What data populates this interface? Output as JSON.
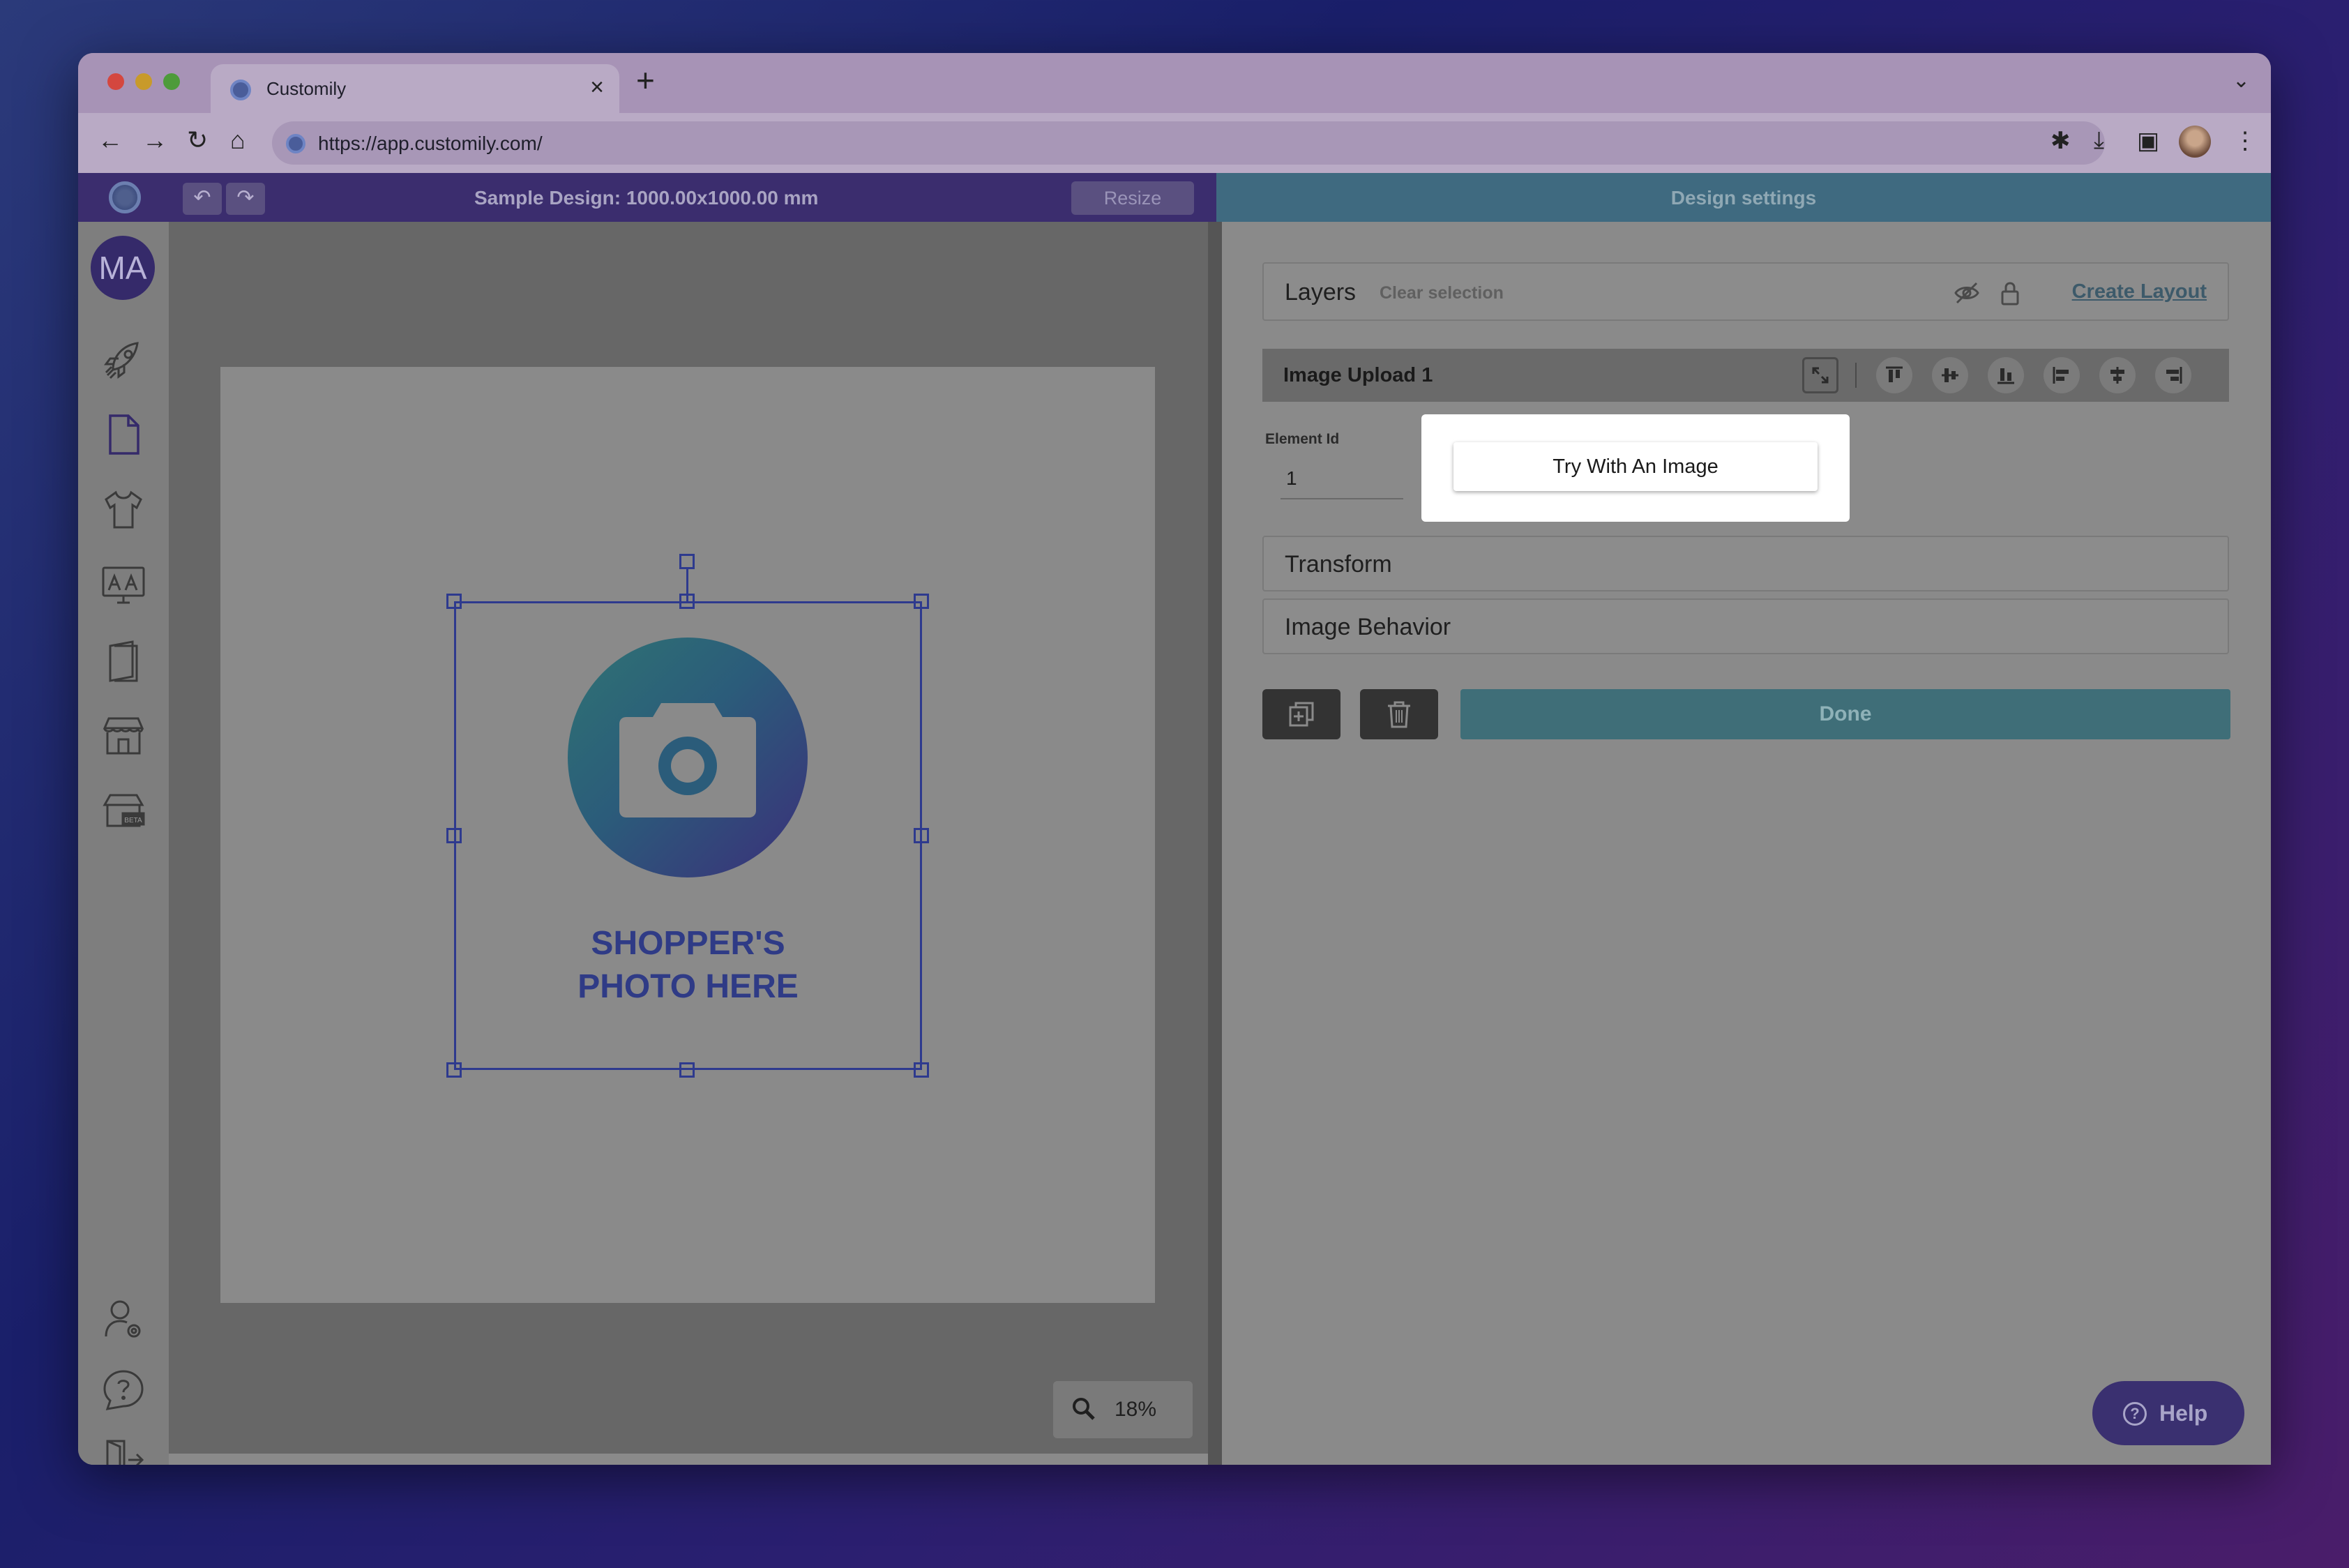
{
  "browser": {
    "tab_title": "Customily",
    "tab_close": "×",
    "new_tab": "+",
    "tab_menu": "⌄",
    "url": "https://app.customily.com/"
  },
  "app_header": {
    "design_title": "Sample Design: 1000.00x1000.00 mm",
    "resize_label": "Resize",
    "undo_label": "↶",
    "redo_label": "↷",
    "settings_title": "Design settings"
  },
  "sidebar": {
    "user_initials": "MA",
    "icons": [
      "rocket-icon",
      "document-icon",
      "tshirt-icon",
      "monitor-icon",
      "book-icon",
      "store-icon",
      "store-beta-icon",
      "user-settings-icon",
      "help-chat-icon",
      "logout-icon"
    ]
  },
  "canvas": {
    "placeholder_line1": "SHOPPER'S",
    "placeholder_line2": "PHOTO HERE",
    "zoom": "18%"
  },
  "panel": {
    "layers_title": "Layers",
    "clear_selection": "Clear selection",
    "create_layout": "Create Layout",
    "element_title": "Image Upload 1",
    "element_id_label": "Element Id",
    "element_id_value": "1",
    "try_image_label": "Try With An Image",
    "transform_label": "Transform",
    "image_behavior_label": "Image Behavior",
    "done_label": "Done"
  },
  "help": {
    "label": "Help",
    "icon_text": "?"
  },
  "colors": {
    "accent": "#3b2d6e",
    "teal": "#3f6e78",
    "selection": "#2e3a8e"
  }
}
